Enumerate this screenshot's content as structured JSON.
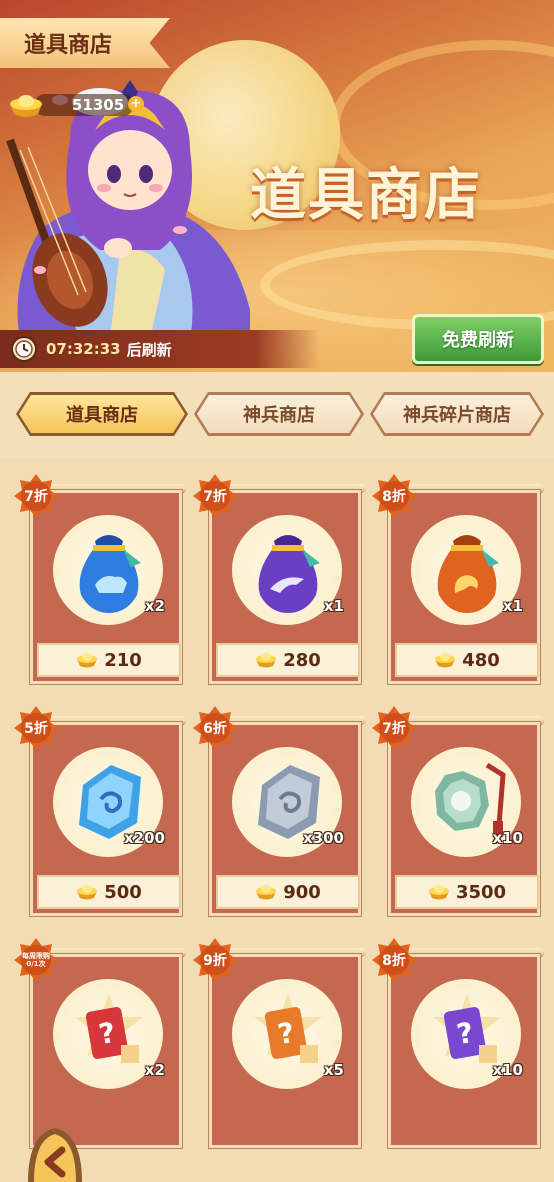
{
  "header": {
    "tab_title": "道具商店",
    "currency_amount": "51305",
    "currency_plus": "+",
    "banner_title": "道具商店",
    "timer": "07:32:33",
    "timer_suffix": "后刷新",
    "refresh_button": "免费刷新"
  },
  "tabs": [
    {
      "label": "道具商店",
      "active": true
    },
    {
      "label": "神兵商店",
      "active": false
    },
    {
      "label": "神兵碎片商店",
      "active": false
    }
  ],
  "items": [
    {
      "discount": "7折",
      "quantity": "x2",
      "price": "210",
      "icon": "blue-qilin-bag-icon",
      "color": "#2f7de0"
    },
    {
      "discount": "7折",
      "quantity": "x1",
      "price": "280",
      "icon": "purple-crane-bag-icon",
      "color": "#6a3fc4"
    },
    {
      "discount": "8折",
      "quantity": "x1",
      "price": "480",
      "icon": "orange-phoenix-bag-icon",
      "color": "#e0641f"
    },
    {
      "discount": "5折",
      "quantity": "x200",
      "price": "500",
      "icon": "blue-rune-stone-icon",
      "color": "#3ea2e6"
    },
    {
      "discount": "6折",
      "quantity": "x300",
      "price": "900",
      "icon": "gray-rune-stone-icon",
      "color": "#9aa7b8"
    },
    {
      "discount": "7折",
      "quantity": "x10",
      "price": "3500",
      "icon": "jade-talisman-icon",
      "color": "#7fb7a2"
    },
    {
      "discount": "每周限购0/1次",
      "quantity": "x2",
      "price": "",
      "icon": "red-mystery-card-icon",
      "color": "#d7373a"
    },
    {
      "discount": "9折",
      "quantity": "x5",
      "price": "",
      "icon": "orange-mystery-card-icon",
      "color": "#e87a2a"
    },
    {
      "discount": "8折",
      "quantity": "x10",
      "price": "",
      "icon": "purple-mystery-card-icon",
      "color": "#7a48d0"
    }
  ]
}
